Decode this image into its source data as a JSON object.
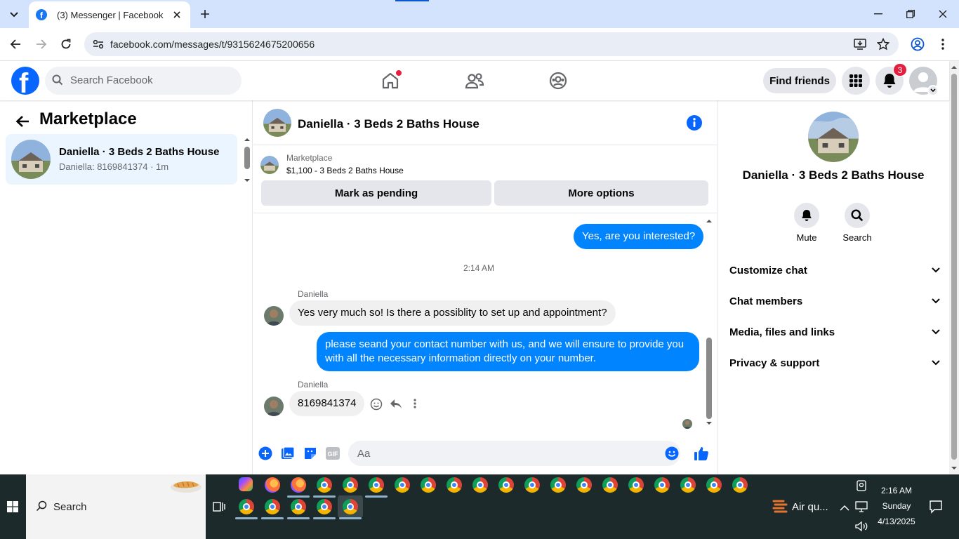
{
  "browser": {
    "tab_title": "(3) Messenger | Facebook",
    "url": "facebook.com/messages/t/9315624675200656"
  },
  "header": {
    "search_placeholder": "Search Facebook",
    "find_friends": "Find friends",
    "notification_count": "3"
  },
  "sidebar": {
    "title": "Marketplace",
    "conversations": [
      {
        "name": "Daniella · 3 Beds 2 Baths House",
        "preview": "Daniella: 8169841374 · 1m"
      }
    ]
  },
  "chat": {
    "title": "Daniella · 3 Beds 2 Baths House",
    "marketplace_label": "Marketplace",
    "listing": "$1,100 - 3 Beds 2 Baths House",
    "mark_pending": "Mark as pending",
    "more_options": "More options",
    "messages": [
      {
        "from": "me",
        "text": "Yes, are you interested?"
      },
      {
        "type": "timestamp",
        "text": "2:14 AM"
      },
      {
        "from": "Daniella",
        "sender_label": "Daniella",
        "text": "Yes very much so! Is there a possiblity to set up and appointment?"
      },
      {
        "from": "me",
        "text": "please seand your contact number with us, and we will ensure to provide you with all the necessary information directly on your number."
      },
      {
        "from": "Daniella",
        "sender_label": "Daniella",
        "text": "8169841374"
      }
    ],
    "composer_placeholder": "Aa"
  },
  "right_panel": {
    "name": "Daniella · 3 Beds 2 Baths House",
    "actions": [
      "Mute",
      "Search"
    ],
    "sections": [
      "Customize chat",
      "Chat members",
      "Media, files and links",
      "Privacy & support"
    ]
  },
  "taskbar": {
    "search_label": "Search",
    "weather": "Air qu...",
    "time": "2:16 AM",
    "day": "Sunday",
    "date": "4/13/2025"
  },
  "colors": {
    "fb_blue": "#0866ff",
    "messenger_blue": "#0084ff",
    "selected_row": "#ebf5ff",
    "tabstrip": "#d3e3fd",
    "taskbar": "#1c2a2c"
  }
}
